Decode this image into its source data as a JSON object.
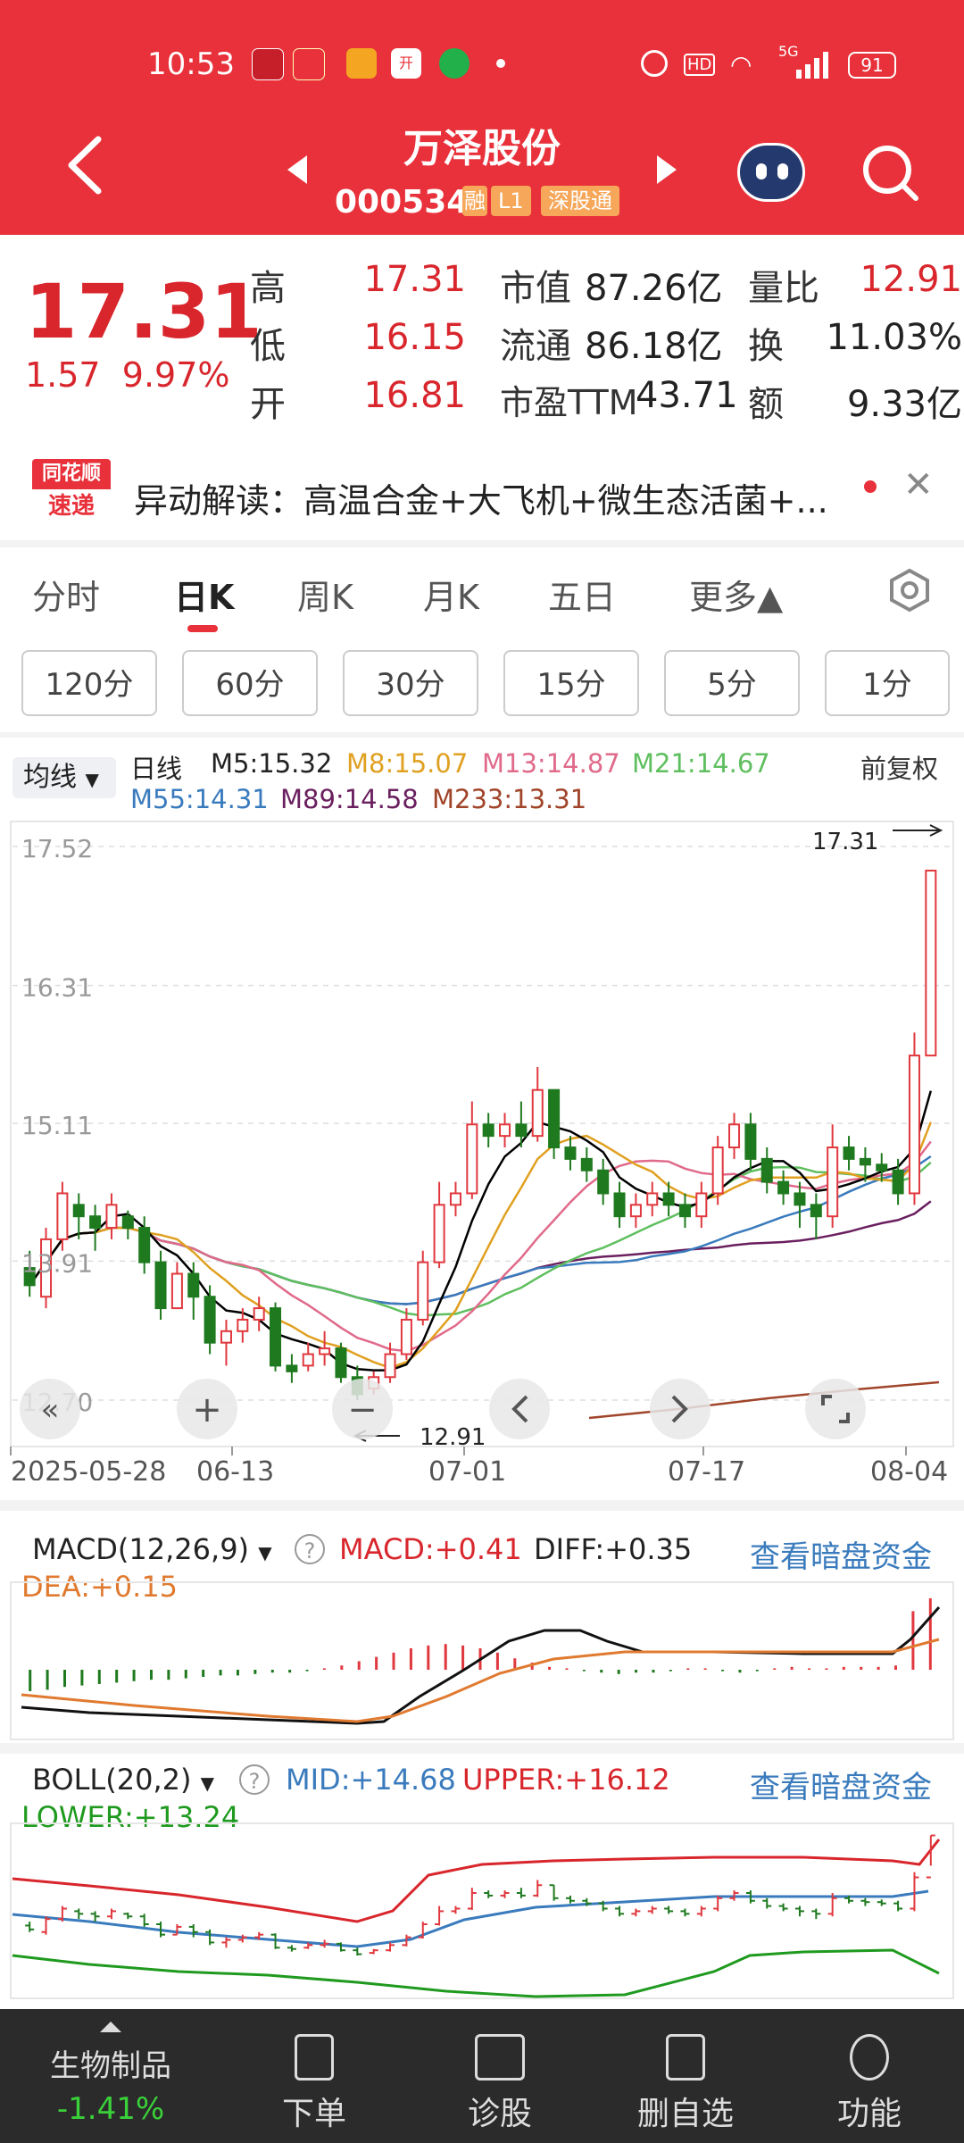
{
  "status_bar": {
    "time": "10:53",
    "signal": "5G",
    "hd": "HD",
    "battery": "91"
  },
  "header": {
    "title": "万泽股份",
    "code": "000534",
    "badges": [
      "融",
      "L1",
      "深股通"
    ]
  },
  "quote": {
    "price": "17.31",
    "change": "1.57",
    "change_pct": "9.97%",
    "high_label": "高",
    "high": "17.31",
    "low_label": "低",
    "low": "16.15",
    "open_label": "开",
    "open": "16.81",
    "mktcap_label": "市值",
    "mktcap": "87.26亿",
    "float_label": "流通",
    "float": "86.18亿",
    "pe_label": "市盈TTM",
    "pe": "43.71",
    "vr_label": "量比",
    "vr": "12.91",
    "turnover_label": "换",
    "turnover": "11.03%",
    "amount_label": "额",
    "amount": "9.33亿"
  },
  "news": {
    "logo_line1": "同花顺",
    "logo_line2": "速递",
    "text": "异动解读：高温合金+大飞机+微生态活菌+..."
  },
  "period_tabs": [
    "分时",
    "日K",
    "周K",
    "月K",
    "五日",
    "更多▲"
  ],
  "interval_buttons": [
    "120分",
    "60分",
    "30分",
    "15分",
    "5分",
    "1分"
  ],
  "ma": {
    "selector": "均线",
    "type": "日线",
    "m5": "M5:15.32",
    "m8": "M8:15.07",
    "m13": "M13:14.87",
    "m21": "M21:14.67",
    "m55": "M55:14.31",
    "m89": "M89:14.58",
    "m233": "M233:13.31",
    "adjust": "前复权"
  },
  "chart_data": [
    {
      "type": "candlestick",
      "y_ticks": [
        "17.52",
        "16.31",
        "15.11",
        "13.91",
        "12.70"
      ],
      "ylim": [
        12.7,
        17.52
      ],
      "x_ticks": [
        "2025-05-28",
        "06-13",
        "07-01",
        "07-17",
        "08-04"
      ],
      "high_marker": "17.31",
      "low_marker": "12.91",
      "candles": [
        [
          13.85,
          13.7,
          14.0,
          13.6
        ],
        [
          13.6,
          14.1,
          14.2,
          13.5
        ],
        [
          14.1,
          14.5,
          14.6,
          14.0
        ],
        [
          14.4,
          14.3,
          14.5,
          14.1
        ],
        [
          14.3,
          14.2,
          14.4,
          14.0
        ],
        [
          14.2,
          14.4,
          14.5,
          14.1
        ],
        [
          14.3,
          14.2,
          14.35,
          14.1
        ],
        [
          14.2,
          13.9,
          14.3,
          13.8
        ],
        [
          13.9,
          13.5,
          14.0,
          13.4
        ],
        [
          13.5,
          13.8,
          13.9,
          13.5
        ],
        [
          13.8,
          13.6,
          13.9,
          13.4
        ],
        [
          13.6,
          13.2,
          13.7,
          13.1
        ],
        [
          13.2,
          13.3,
          13.4,
          13.0
        ],
        [
          13.3,
          13.4,
          13.5,
          13.2
        ],
        [
          13.4,
          13.5,
          13.6,
          13.3
        ],
        [
          13.5,
          13.0,
          13.55,
          12.95
        ],
        [
          13.0,
          12.95,
          13.1,
          12.85
        ],
        [
          13.0,
          13.1,
          13.2,
          12.95
        ],
        [
          13.1,
          13.15,
          13.3,
          13.0
        ],
        [
          13.15,
          12.9,
          13.2,
          12.85
        ],
        [
          12.9,
          12.75,
          13.0,
          12.7
        ],
        [
          12.8,
          12.9,
          12.95,
          12.75
        ],
        [
          12.9,
          13.1,
          13.2,
          12.85
        ],
        [
          13.1,
          13.4,
          13.5,
          13.05
        ],
        [
          13.4,
          13.9,
          14.0,
          13.35
        ],
        [
          13.9,
          14.4,
          14.6,
          13.85
        ],
        [
          14.4,
          14.5,
          14.6,
          14.3
        ],
        [
          14.5,
          15.1,
          15.3,
          14.45
        ],
        [
          15.1,
          15.0,
          15.2,
          14.9
        ],
        [
          15.0,
          15.1,
          15.2,
          14.9
        ],
        [
          15.1,
          15.0,
          15.3,
          14.9
        ],
        [
          15.0,
          15.4,
          15.6,
          14.95
        ],
        [
          15.4,
          14.9,
          15.4,
          14.8
        ],
        [
          14.9,
          14.8,
          15.0,
          14.7
        ],
        [
          14.8,
          14.7,
          14.9,
          14.6
        ],
        [
          14.7,
          14.5,
          14.8,
          14.4
        ],
        [
          14.5,
          14.3,
          14.6,
          14.2
        ],
        [
          14.3,
          14.4,
          14.5,
          14.2
        ],
        [
          14.4,
          14.5,
          14.6,
          14.3
        ],
        [
          14.5,
          14.4,
          14.6,
          14.3
        ],
        [
          14.4,
          14.3,
          14.5,
          14.2
        ],
        [
          14.3,
          14.5,
          14.6,
          14.2
        ],
        [
          14.5,
          14.9,
          15.0,
          14.4
        ],
        [
          14.9,
          15.1,
          15.2,
          14.8
        ],
        [
          15.1,
          14.8,
          15.2,
          14.7
        ],
        [
          14.8,
          14.6,
          14.9,
          14.5
        ],
        [
          14.6,
          14.5,
          14.7,
          14.4
        ],
        [
          14.5,
          14.4,
          14.6,
          14.2
        ],
        [
          14.4,
          14.3,
          14.5,
          14.1
        ],
        [
          14.3,
          14.9,
          15.1,
          14.2
        ],
        [
          14.9,
          14.8,
          15.0,
          14.7
        ],
        [
          14.8,
          14.75,
          14.9,
          14.6
        ],
        [
          14.75,
          14.7,
          14.85,
          14.6
        ],
        [
          14.7,
          14.5,
          14.8,
          14.4
        ],
        [
          14.5,
          15.7,
          15.9,
          14.4
        ],
        [
          15.7,
          17.31,
          17.31,
          16.15
        ]
      ]
    },
    {
      "type": "bar",
      "title": "MACD(12,26,9)",
      "macd": "MACD:+0.41",
      "diff": "DIFF:+0.35",
      "dea": "DEA:+0.15",
      "link": "查看暗盘资金",
      "values": [
        -0.15,
        -0.14,
        -0.12,
        -0.11,
        -0.1,
        -0.09,
        -0.08,
        -0.07,
        -0.07,
        -0.06,
        -0.05,
        -0.04,
        -0.04,
        -0.03,
        -0.02,
        -0.02,
        -0.01,
        0.01,
        0.03,
        0.06,
        0.09,
        0.12,
        0.15,
        0.17,
        0.18,
        0.17,
        0.15,
        0.12,
        0.08,
        0.05,
        0.02,
        0.01,
        -0.01,
        -0.02,
        -0.03,
        -0.02,
        -0.02,
        -0.01,
        0.01,
        0.01,
        -0.01,
        -0.02,
        -0.01,
        0.01,
        0.02,
        0.01,
        0.01,
        0.02,
        0.02,
        0.02,
        0.03,
        0.41,
        0.5
      ]
    },
    {
      "type": "line",
      "title": "BOLL(20,2)",
      "mid": "MID:+14.68",
      "upper": "UPPER:+16.12",
      "lower": "LOWER:+13.24",
      "link": "查看暗盘资金"
    }
  ],
  "bottom_bar": {
    "sector_name": "生物制品",
    "sector_change": "-1.41%",
    "items": [
      "下单",
      "诊股",
      "删自选",
      "功能"
    ]
  },
  "colors": {
    "brand": "#e8313a",
    "rise": "#e0383e",
    "fall": "#1f7a1f",
    "ma5": "#000000",
    "ma8": "#e0a020",
    "ma13": "#e06a8a",
    "ma21": "#5fbf5f",
    "ma55": "#3a7bbd",
    "ma89": "#6a1f5f",
    "ma233": "#a0452a"
  }
}
